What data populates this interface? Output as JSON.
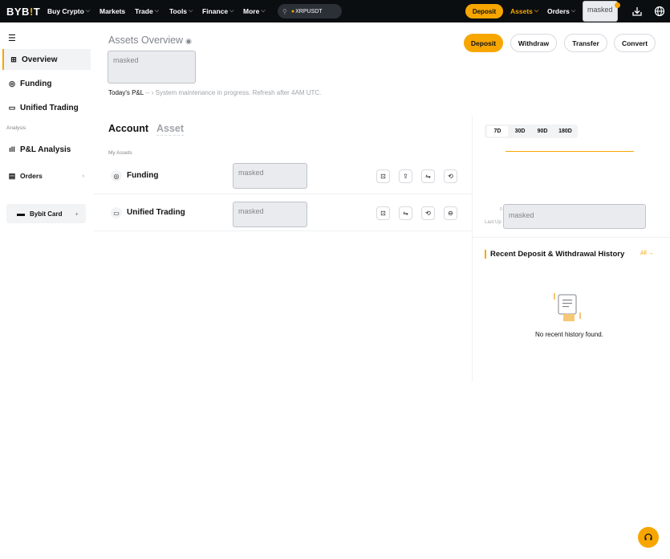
{
  "brand": {
    "name_prefix": "BYB",
    "name_bang": "!",
    "name_suffix": "T"
  },
  "topnav": {
    "items": [
      {
        "label": "Buy Crypto",
        "has_menu": true
      },
      {
        "label": "Markets",
        "has_menu": false
      },
      {
        "label": "Trade",
        "has_menu": true
      },
      {
        "label": "Tools",
        "has_menu": true
      },
      {
        "label": "Finance",
        "has_menu": true
      },
      {
        "label": "More",
        "has_menu": true
      }
    ],
    "search_value": "XRPUSDT",
    "deposit_label": "Deposit",
    "assets_label": "Assets",
    "orders_label": "Orders",
    "account_masked": "masked"
  },
  "sidebar": {
    "items": [
      {
        "label": "Overview",
        "icon": "overview-icon",
        "active": true
      },
      {
        "label": "Funding",
        "icon": "funding-icon"
      },
      {
        "label": "Unified Trading",
        "icon": "unified-trading-icon"
      }
    ],
    "section_label": "Analysis",
    "analysis_items": [
      {
        "label": "P&L Analysis",
        "icon": "chart-icon"
      },
      {
        "label": "Orders",
        "icon": "orders-icon"
      }
    ],
    "card_label": "Bybit Card",
    "card_plus": "+"
  },
  "overview": {
    "title": "Assets Overview",
    "balance_masked": "masked",
    "pnl_label": "Today's P&L",
    "pnl_value": "--",
    "pnl_notice": "System maintenance in progress. Refresh after 4AM UTC.",
    "actions": [
      "Deposit",
      "Withdraw",
      "Transfer",
      "Convert"
    ]
  },
  "accounts": {
    "tabs": [
      "Account",
      "Asset"
    ],
    "section_label": "My Assets",
    "rows": [
      {
        "name": "Funding",
        "value_masked": "masked"
      },
      {
        "name": "Unified Trading",
        "value_masked": "masked"
      }
    ]
  },
  "chart": {
    "periods": [
      "7D",
      "30D",
      "90D",
      "180D"
    ],
    "active_period": "7D",
    "axis_value": "0",
    "last_updated_label": "Last Up",
    "value_masked": "masked"
  },
  "history": {
    "title": "Recent Deposit & Withdrawal History",
    "all_label": "All",
    "empty_text": "No recent history found."
  },
  "colors": {
    "accent": "#f7a600",
    "topbar": "#0b0e11",
    "muted": "#81858c"
  }
}
